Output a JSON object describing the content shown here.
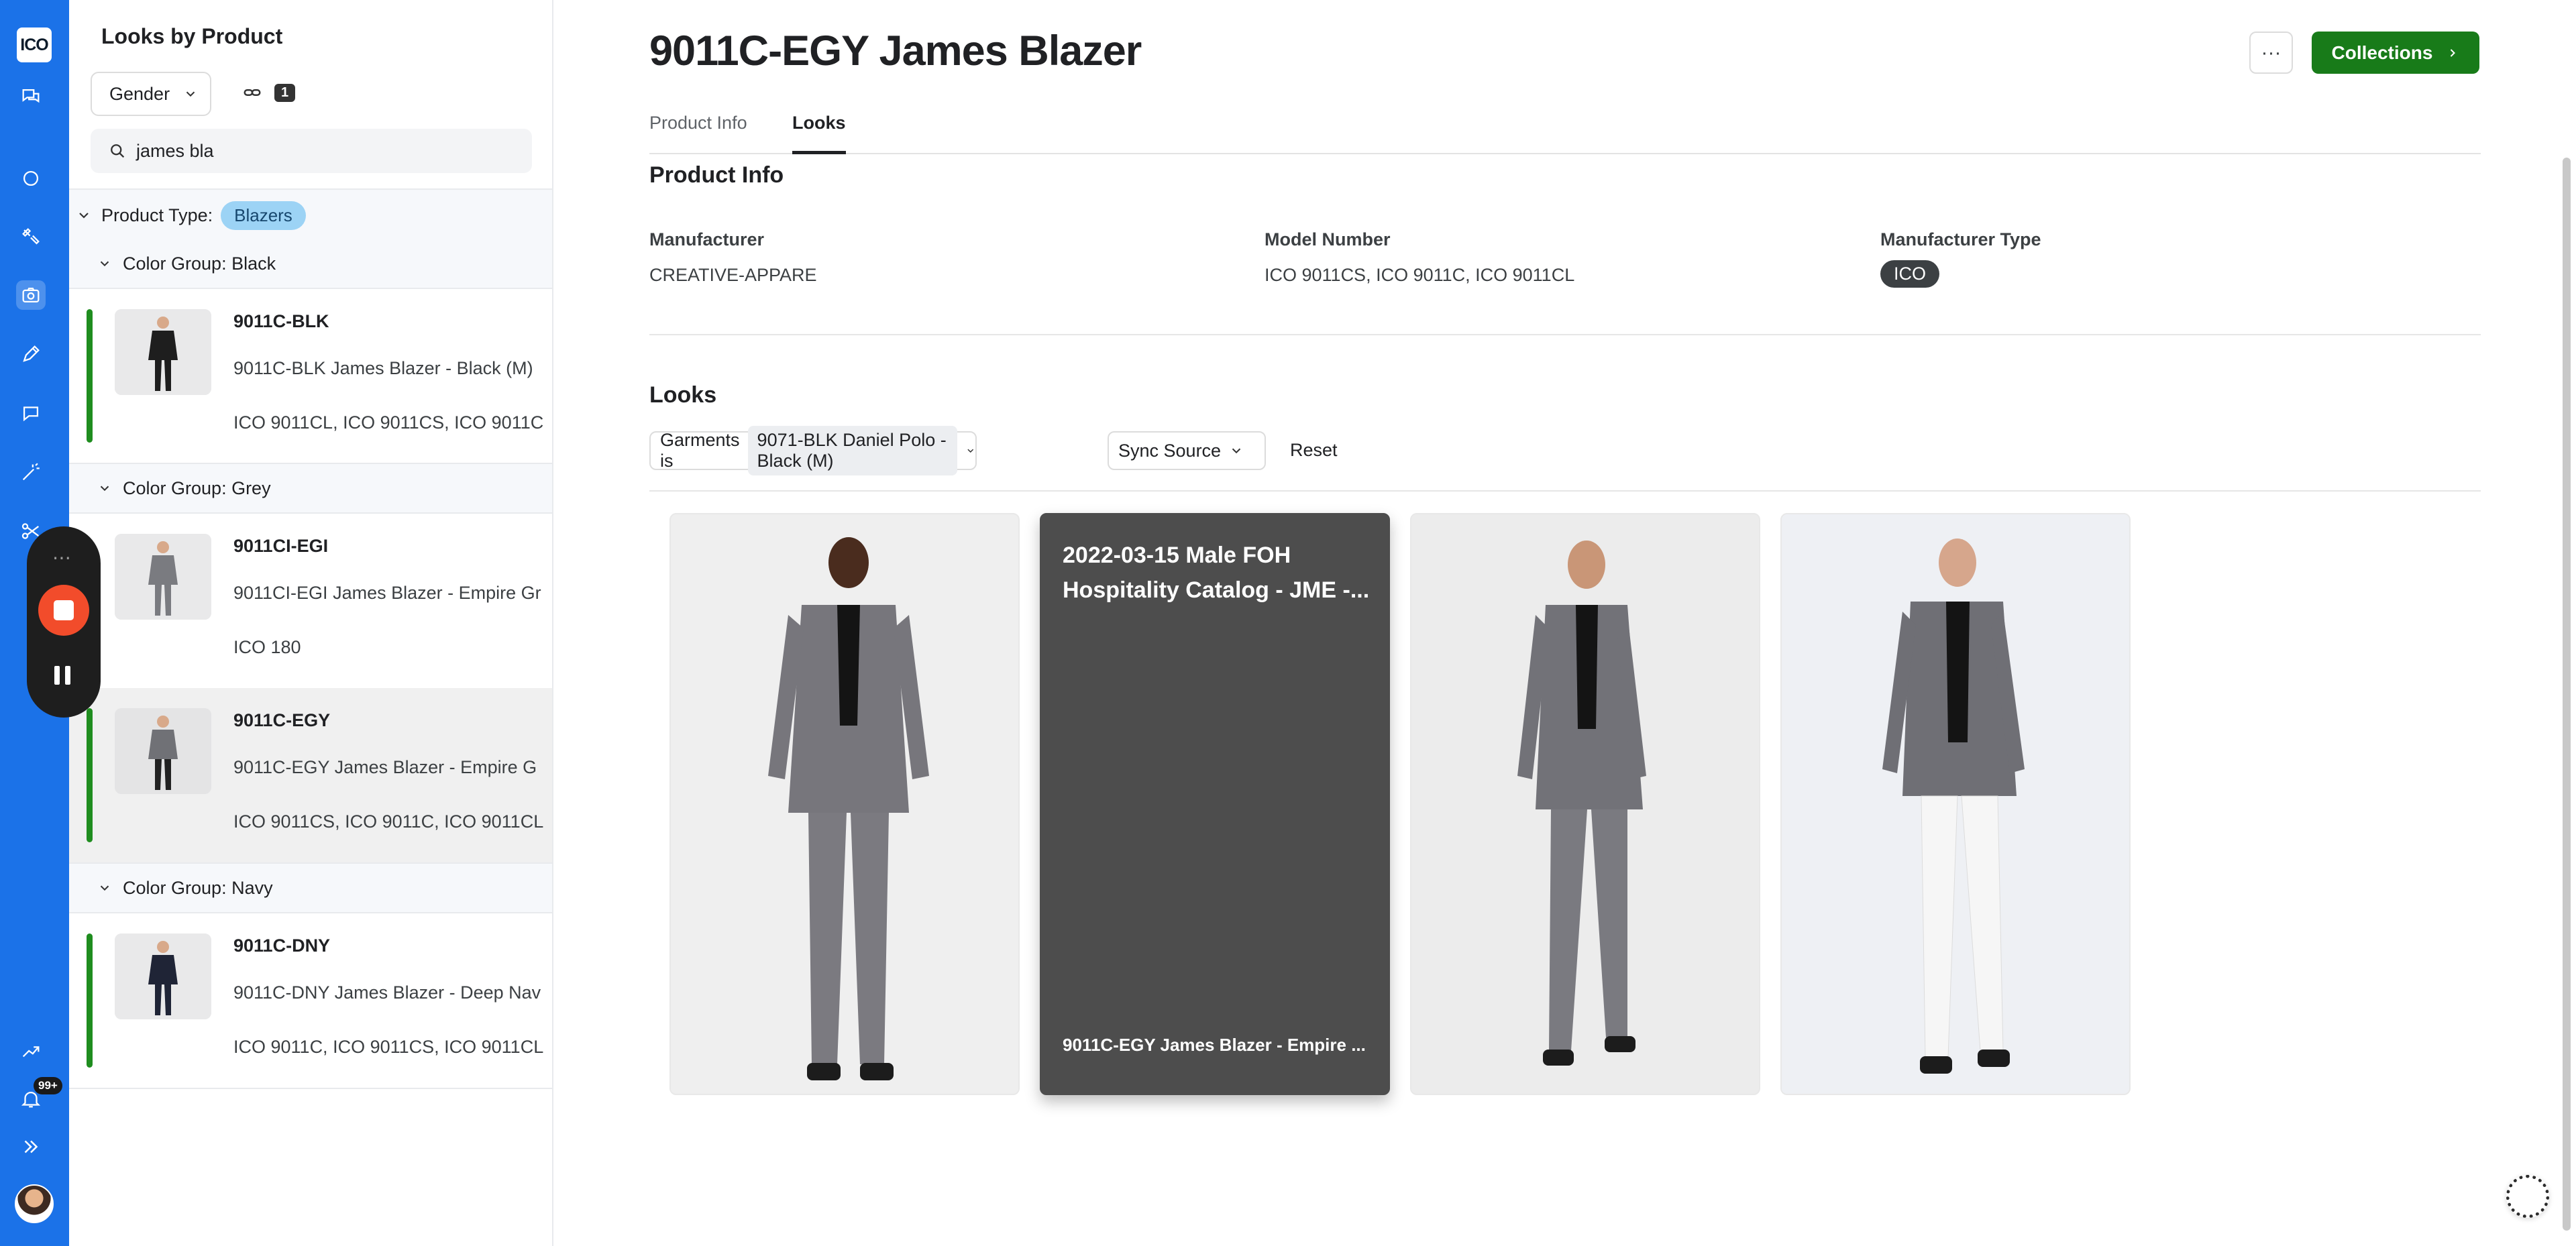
{
  "rail": {
    "logo": "ICO",
    "notifications_badge": "99+"
  },
  "panel": {
    "title": "Looks by Product",
    "gender_filter": "Gender",
    "linked_count": "1",
    "search_value": "james bla",
    "product_type_label": "Product Type:",
    "product_type_value": "Blazers",
    "groups": {
      "black": "Color Group: Black",
      "grey": "Color Group: Grey",
      "navy": "Color Group: Navy"
    },
    "items": [
      {
        "code": "9011C-BLK",
        "name": "9011C-BLK James Blazer - Black (M)",
        "models": "ICO 9011CL, ICO 9011CS, ICO 9011C"
      },
      {
        "code": "9011CI-EGI",
        "name": "9011CI-EGI James Blazer - Empire Gr",
        "models": "ICO 180"
      },
      {
        "code": "9011C-EGY",
        "name": "9011C-EGY James Blazer - Empire G",
        "models": "ICO 9011CS, ICO 9011C, ICO 9011CL"
      },
      {
        "code": "9011C-DNY",
        "name": "9011C-DNY James Blazer - Deep Nav",
        "models": "ICO 9011C, ICO 9011CS, ICO 9011CL"
      }
    ]
  },
  "main": {
    "title": "9011C-EGY James Blazer",
    "more_label": "···",
    "collections_label": "Collections",
    "tabs": [
      "Product Info",
      "Looks"
    ],
    "product_info": {
      "heading": "Product Info",
      "manufacturer_label": "Manufacturer",
      "manufacturer_value": "CREATIVE-APPARE",
      "model_label": "Model Number",
      "model_value": "ICO 9011CS, ICO 9011C, ICO 9011CL",
      "type_label": "Manufacturer Type",
      "type_value": "ICO"
    },
    "looks": {
      "heading": "Looks",
      "filter_prefix": "Garments is",
      "filter_value": "9071-BLK Daniel Polo - Black (M)",
      "sync_source": "Sync Source",
      "reset": "Reset",
      "hover_card_title": "2022-03-15 Male FOH Hospitality Catalog - JME -...",
      "hover_card_footer": "9011C-EGY James Blazer - Empire ..."
    }
  },
  "colors": {
    "rail": "#1b72e8",
    "primary_button": "#187b19",
    "selection_bar": "#1f8d1f",
    "type_chip": "#9cd3f5"
  }
}
